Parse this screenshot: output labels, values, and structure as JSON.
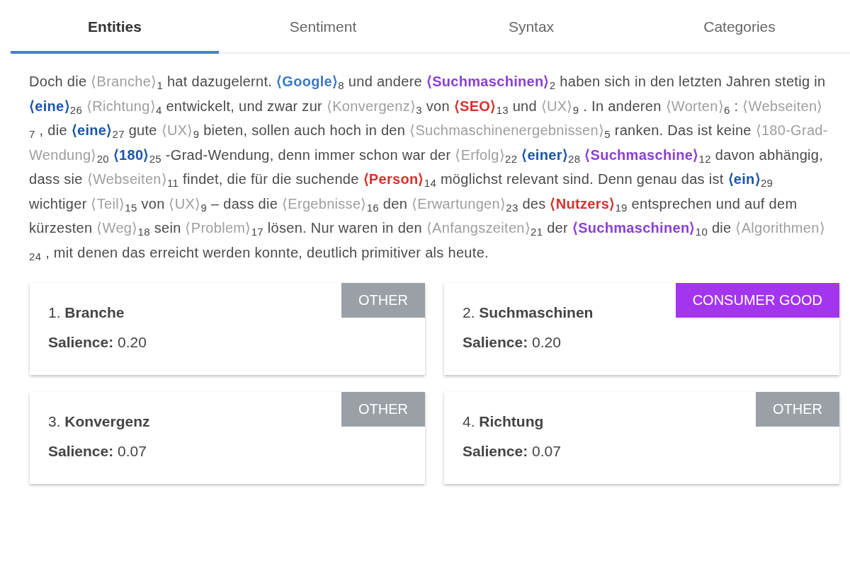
{
  "tabs": [
    {
      "label": "Entities",
      "selected": true
    },
    {
      "label": "Sentiment",
      "selected": false
    },
    {
      "label": "Syntax",
      "selected": false
    },
    {
      "label": "Categories",
      "selected": false
    }
  ],
  "paragraph": [
    {
      "kind": "text",
      "text": "Doch die "
    },
    {
      "kind": "entity",
      "text": "⟨Branche⟩",
      "sub": "1",
      "color": "#9e9e9e"
    },
    {
      "kind": "text",
      "text": " hat dazugelernt. "
    },
    {
      "kind": "entity",
      "text": "⟨Google⟩",
      "sub": "8",
      "color": "#3b78c9"
    },
    {
      "kind": "text",
      "text": " und andere "
    },
    {
      "kind": "entity",
      "text": "⟨Suchmaschinen⟩",
      "sub": "2",
      "color": "#8a3fd6"
    },
    {
      "kind": "text",
      "text": " haben sich in den letzten Jahren stetig in "
    },
    {
      "kind": "entity",
      "text": "⟨eine⟩",
      "sub": "26",
      "color": "#1a56a8"
    },
    {
      "kind": "entity",
      "text": " ⟨Richtung⟩",
      "sub": "4",
      "color": "#9e9e9e"
    },
    {
      "kind": "text",
      "text": " entwickelt, und zwar zur "
    },
    {
      "kind": "entity",
      "text": "⟨Konvergenz⟩",
      "sub": "3",
      "color": "#9e9e9e"
    },
    {
      "kind": "text",
      "text": " von "
    },
    {
      "kind": "entity",
      "text": "⟨SEO⟩",
      "sub": "13",
      "color": "#d2322d"
    },
    {
      "kind": "text",
      "text": " und "
    },
    {
      "kind": "entity",
      "text": "⟨UX⟩",
      "sub": "9",
      "color": "#9e9e9e"
    },
    {
      "kind": "text",
      "text": " . In anderen "
    },
    {
      "kind": "entity",
      "text": "⟨Worten⟩",
      "sub": "6",
      "color": "#9e9e9e"
    },
    {
      "kind": "text",
      "text": " : "
    },
    {
      "kind": "entity",
      "text": "⟨Webseiten⟩",
      "sub": "7",
      "color": "#9e9e9e"
    },
    {
      "kind": "text",
      "text": " , die "
    },
    {
      "kind": "entity",
      "text": "⟨eine⟩",
      "sub": "27",
      "color": "#1a56a8"
    },
    {
      "kind": "text",
      "text": " gute "
    },
    {
      "kind": "entity",
      "text": "⟨UX⟩",
      "sub": "9",
      "color": "#9e9e9e"
    },
    {
      "kind": "text",
      "text": " bieten, sollen auch hoch in den "
    },
    {
      "kind": "entity",
      "text": "⟨Suchmaschinenergebnissen⟩",
      "sub": "5",
      "color": "#9e9e9e"
    },
    {
      "kind": "text",
      "text": " ranken. Das ist keine "
    },
    {
      "kind": "entity",
      "text": "⟨180-Grad-Wendung⟩",
      "sub": "20",
      "color": "#9e9e9e"
    },
    {
      "kind": "entity",
      "text": " ⟨180⟩",
      "sub": "25",
      "color": "#1a56a8"
    },
    {
      "kind": "text",
      "text": " -Grad-Wendung, denn immer schon war der "
    },
    {
      "kind": "entity",
      "text": "⟨Erfolg⟩",
      "sub": "22",
      "color": "#9e9e9e"
    },
    {
      "kind": "entity",
      "text": " ⟨einer⟩",
      "sub": "28",
      "color": "#1a56a8"
    },
    {
      "kind": "entity",
      "text": " ⟨Suchmaschine⟩",
      "sub": "12",
      "color": "#8a3fd6"
    },
    {
      "kind": "text",
      "text": " davon abhängig, dass sie "
    },
    {
      "kind": "entity",
      "text": "⟨Webseiten⟩",
      "sub": "11",
      "color": "#9e9e9e"
    },
    {
      "kind": "text",
      "text": " findet, die für die suchende "
    },
    {
      "kind": "entity",
      "text": "⟨Person⟩",
      "sub": "14",
      "color": "#d2322d"
    },
    {
      "kind": "text",
      "text": " möglichst relevant sind. Denn genau das ist "
    },
    {
      "kind": "entity",
      "text": "⟨ein⟩",
      "sub": "29",
      "color": "#1a56a8"
    },
    {
      "kind": "text",
      "text": " wichtiger "
    },
    {
      "kind": "entity",
      "text": "⟨Teil⟩",
      "sub": "15",
      "color": "#9e9e9e"
    },
    {
      "kind": "text",
      "text": " von "
    },
    {
      "kind": "entity",
      "text": "⟨UX⟩",
      "sub": "9",
      "color": "#9e9e9e"
    },
    {
      "kind": "text",
      "text": " – dass die "
    },
    {
      "kind": "entity",
      "text": "⟨Ergebnisse⟩",
      "sub": "16",
      "color": "#9e9e9e"
    },
    {
      "kind": "text",
      "text": " den "
    },
    {
      "kind": "entity",
      "text": "⟨Erwartungen⟩",
      "sub": "23",
      "color": "#9e9e9e"
    },
    {
      "kind": "text",
      "text": " des "
    },
    {
      "kind": "entity",
      "text": "⟨Nutzers⟩",
      "sub": "19",
      "color": "#d2322d"
    },
    {
      "kind": "text",
      "text": " entsprechen und auf dem kürzesten "
    },
    {
      "kind": "entity",
      "text": "⟨Weg⟩",
      "sub": "18",
      "color": "#9e9e9e"
    },
    {
      "kind": "text",
      "text": " sein "
    },
    {
      "kind": "entity",
      "text": "⟨Problem⟩",
      "sub": "17",
      "color": "#9e9e9e"
    },
    {
      "kind": "text",
      "text": " lösen. Nur waren in den "
    },
    {
      "kind": "entity",
      "text": "⟨Anfangszeiten⟩",
      "sub": "21",
      "color": "#9e9e9e"
    },
    {
      "kind": "text",
      "text": " der "
    },
    {
      "kind": "entity",
      "text": "⟨Suchmaschinen⟩",
      "sub": "10",
      "color": "#8a3fd6"
    },
    {
      "kind": "text",
      "text": " die "
    },
    {
      "kind": "entity",
      "text": "⟨Algorithmen⟩",
      "sub": "24",
      "color": "#9e9e9e"
    },
    {
      "kind": "text",
      "text": " , mit denen das erreicht werden konnte, deutlich primitiver als heute."
    }
  ],
  "entities": [
    {
      "number": "1.",
      "name": "Branche",
      "salience_label": "Salience:",
      "salience": "0.20",
      "type": "OTHER",
      "color": "#9aa0a6"
    },
    {
      "number": "2.",
      "name": "Suchmaschinen",
      "salience_label": "Salience:",
      "salience": "0.20",
      "type": "CONSUMER GOOD",
      "color": "#a335ef"
    },
    {
      "number": "3.",
      "name": "Konvergenz",
      "salience_label": "Salience:",
      "salience": "0.07",
      "type": "OTHER",
      "color": "#9aa0a6"
    },
    {
      "number": "4.",
      "name": "Richtung",
      "salience_label": "Salience:",
      "salience": "0.07",
      "type": "OTHER",
      "color": "#9aa0a6"
    }
  ]
}
